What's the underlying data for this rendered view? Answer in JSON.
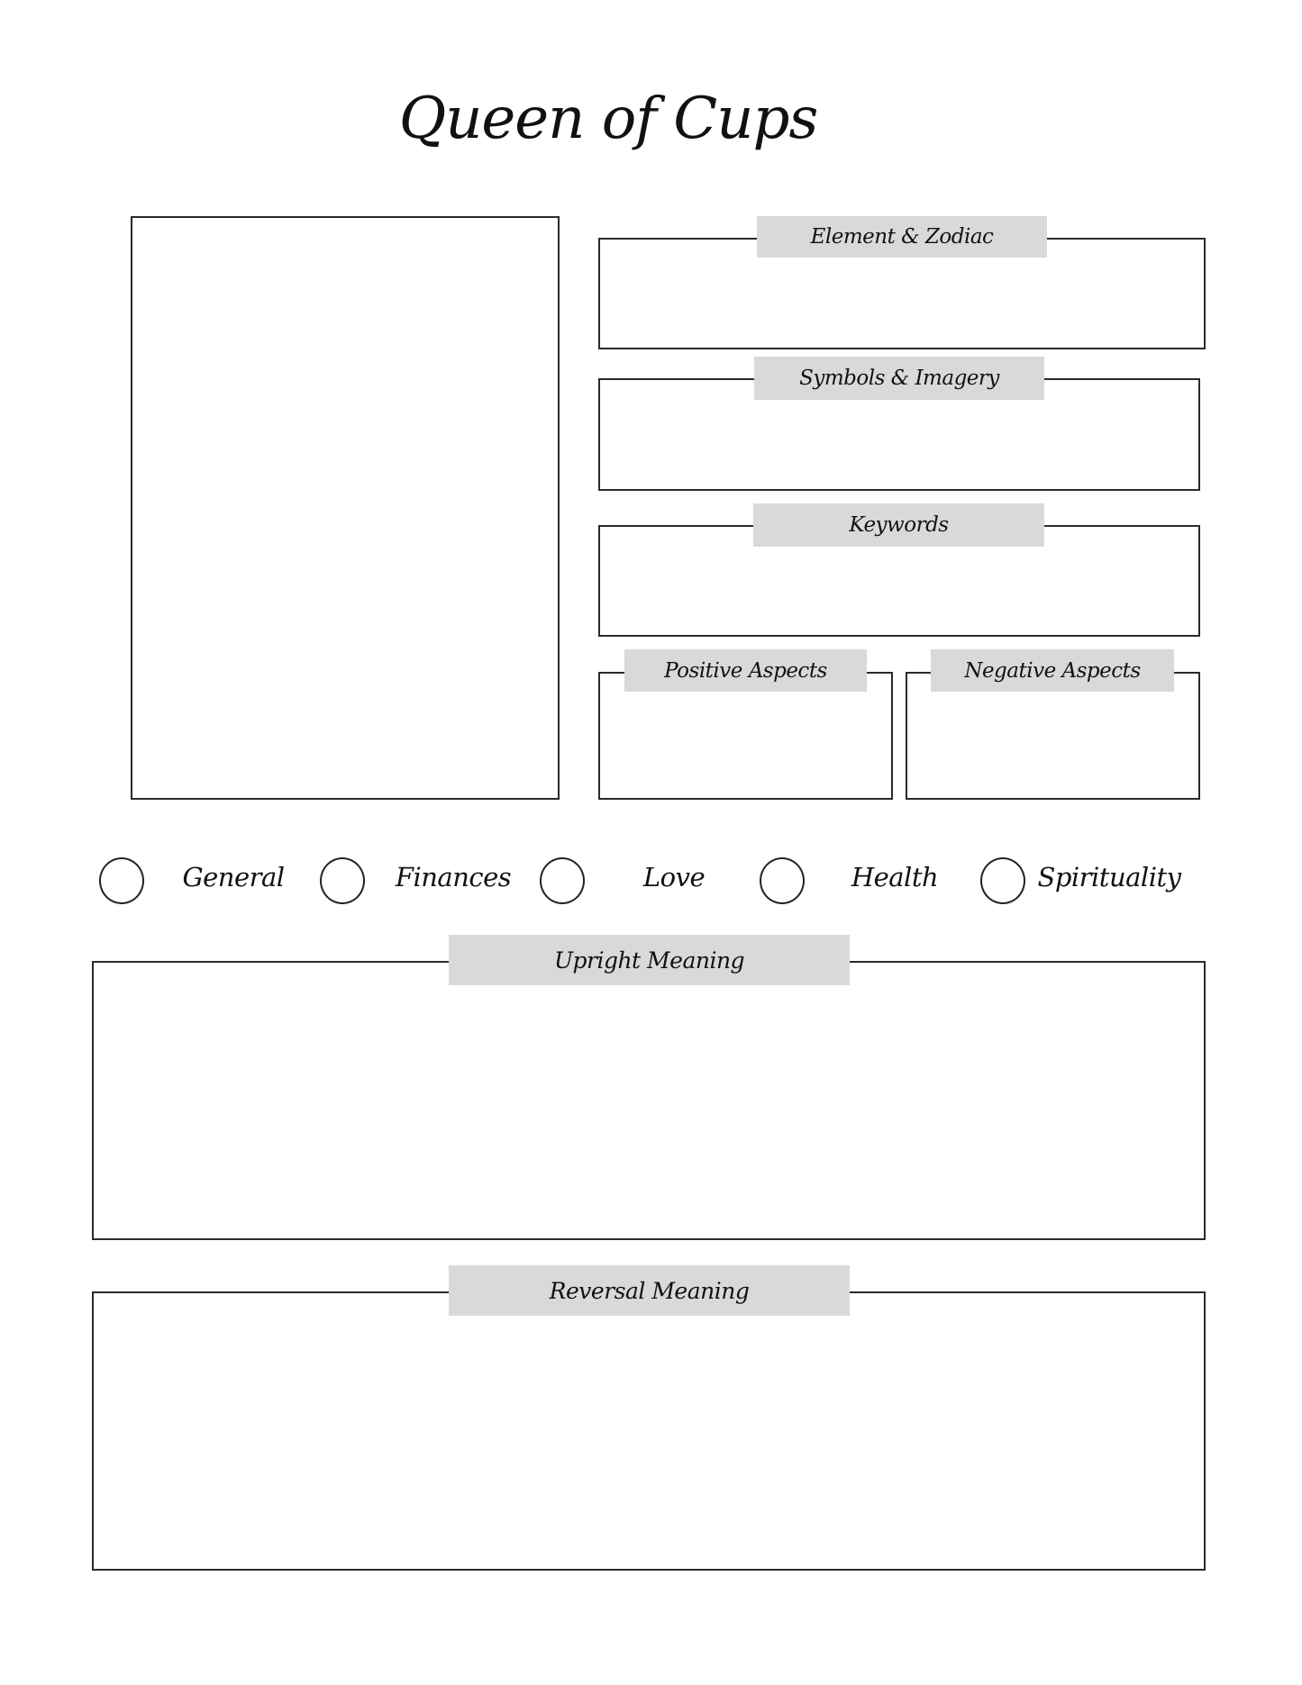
{
  "page": {
    "title": "Queen of Cups"
  },
  "sections": {
    "element_zodiac": "Element & Zodiac",
    "symbols_imagery": "Symbols & Imagery",
    "keywords": "Keywords",
    "positive_aspects": "Positive Aspects",
    "negative_aspects": "Negative Aspects",
    "upright_meaning": "Upright Meaning",
    "reversal_meaning": "Reversal Meaning"
  },
  "categories": [
    {
      "label": "General",
      "checked": false
    },
    {
      "label": "Finances",
      "checked": false
    },
    {
      "label": "Love",
      "checked": false
    },
    {
      "label": "Health",
      "checked": false
    },
    {
      "label": "Spirituality",
      "checked": false
    }
  ],
  "colors": {
    "label_background": "#d9d9d9",
    "border": "#2a2a2a",
    "text": "#111111"
  }
}
